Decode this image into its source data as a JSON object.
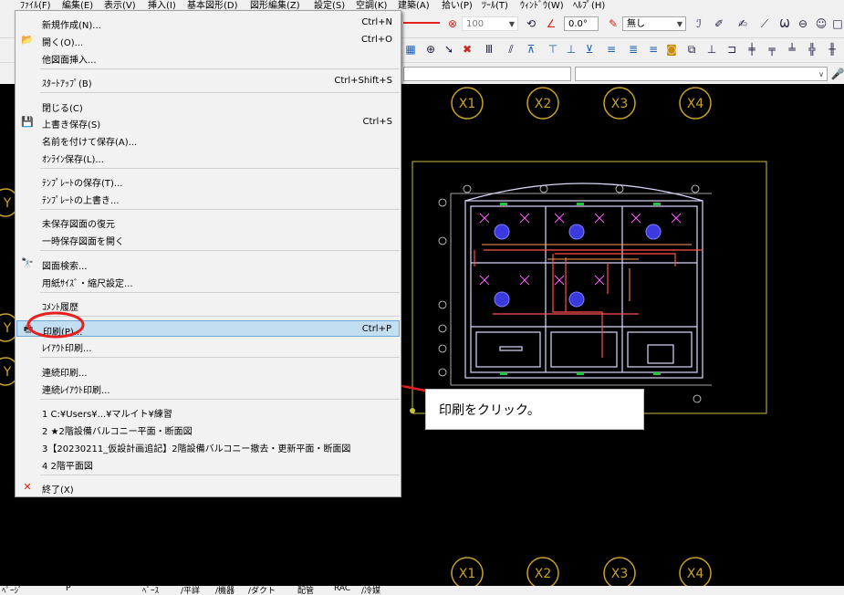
{
  "menubar": {
    "items": [
      "ﾌｧｲﾙ(F)",
      "編集(E)",
      "表示(V)",
      "挿入(I)",
      "基本図形(D)",
      "図形編集(Z)",
      "設定(S)",
      "空調(K)",
      "建築(A)",
      "拾い(P)",
      "ﾂｰﾙ(T)",
      "ｳｨﾝﾄﾞｳ(W)",
      "ﾍﾙﾌﾟ(H)"
    ]
  },
  "toolbar": {
    "value_100": "100",
    "angle": "0.0°",
    "none_label": "無し"
  },
  "grid": {
    "top": [
      "X1",
      "X2",
      "X3",
      "X4"
    ],
    "bottom": [
      "X1",
      "X2",
      "X3",
      "X4"
    ],
    "left": [
      "Y",
      "Y",
      "Y"
    ]
  },
  "menu": {
    "new": {
      "label": "新規作成(N)...",
      "shortcut": "Ctrl+N"
    },
    "open": {
      "label": "開く(O)...",
      "shortcut": "Ctrl+O"
    },
    "insert_other": {
      "label": "他図面挿入..."
    },
    "startup": {
      "label": "ｽﾀｰﾄｱｯﾌﾟ(B)",
      "shortcut": "Ctrl+Shift+S"
    },
    "close": {
      "label": "閉じる(C)"
    },
    "save": {
      "label": "上書き保存(S)",
      "shortcut": "Ctrl+S"
    },
    "save_as": {
      "label": "名前を付けて保存(A)..."
    },
    "online_save": {
      "label": "ｵﾝﾗｲﾝ保存(L)..."
    },
    "save_template": {
      "label": "ﾃﾝﾌﾟﾚｰﾄの保存(T)..."
    },
    "overwrite_template": {
      "label": "ﾃﾝﾌﾟﾚｰﾄの上書き..."
    },
    "restore_unsaved": {
      "label": "未保存図面の復元"
    },
    "open_temp": {
      "label": "一時保存図面を開く"
    },
    "search": {
      "label": "図面検索..."
    },
    "paper_size": {
      "label": "用紙ｻｲｽﾞ・縮尺設定..."
    },
    "comment_history": {
      "label": "ｺﾒﾝﾄ履歴"
    },
    "print": {
      "label": "印刷(P)...",
      "shortcut": "Ctrl+P"
    },
    "layout_print": {
      "label": "ﾚｲｱｳﾄ印刷..."
    },
    "continuous_print": {
      "label": "連続印刷..."
    },
    "continuous_layout_print": {
      "label": "連続ﾚｲｱｳﾄ印刷..."
    },
    "recent": [
      "1 C:¥Users¥...¥マルイト¥練習",
      "2 ★2階設備バルコニー平面・断面図",
      "3【20230211_仮設計画追記】2階設備バルコニー撤去・更新平面・断面図",
      "4 2階平面図"
    ],
    "exit": {
      "label": "終了(X)"
    }
  },
  "callout": {
    "text": "印刷をクリック。"
  },
  "status": {
    "items": [
      "ﾍﾟｰｼﾞ",
      "P",
      "ﾍﾞｰｽ",
      "/平詳",
      "/機器",
      "/ダクト",
      "配管",
      "RAC",
      "/冷媒"
    ]
  },
  "colors": {
    "highlight_red": "#e8201c",
    "selection": "#c3ddf1",
    "grid_gold": "#c9a227"
  }
}
